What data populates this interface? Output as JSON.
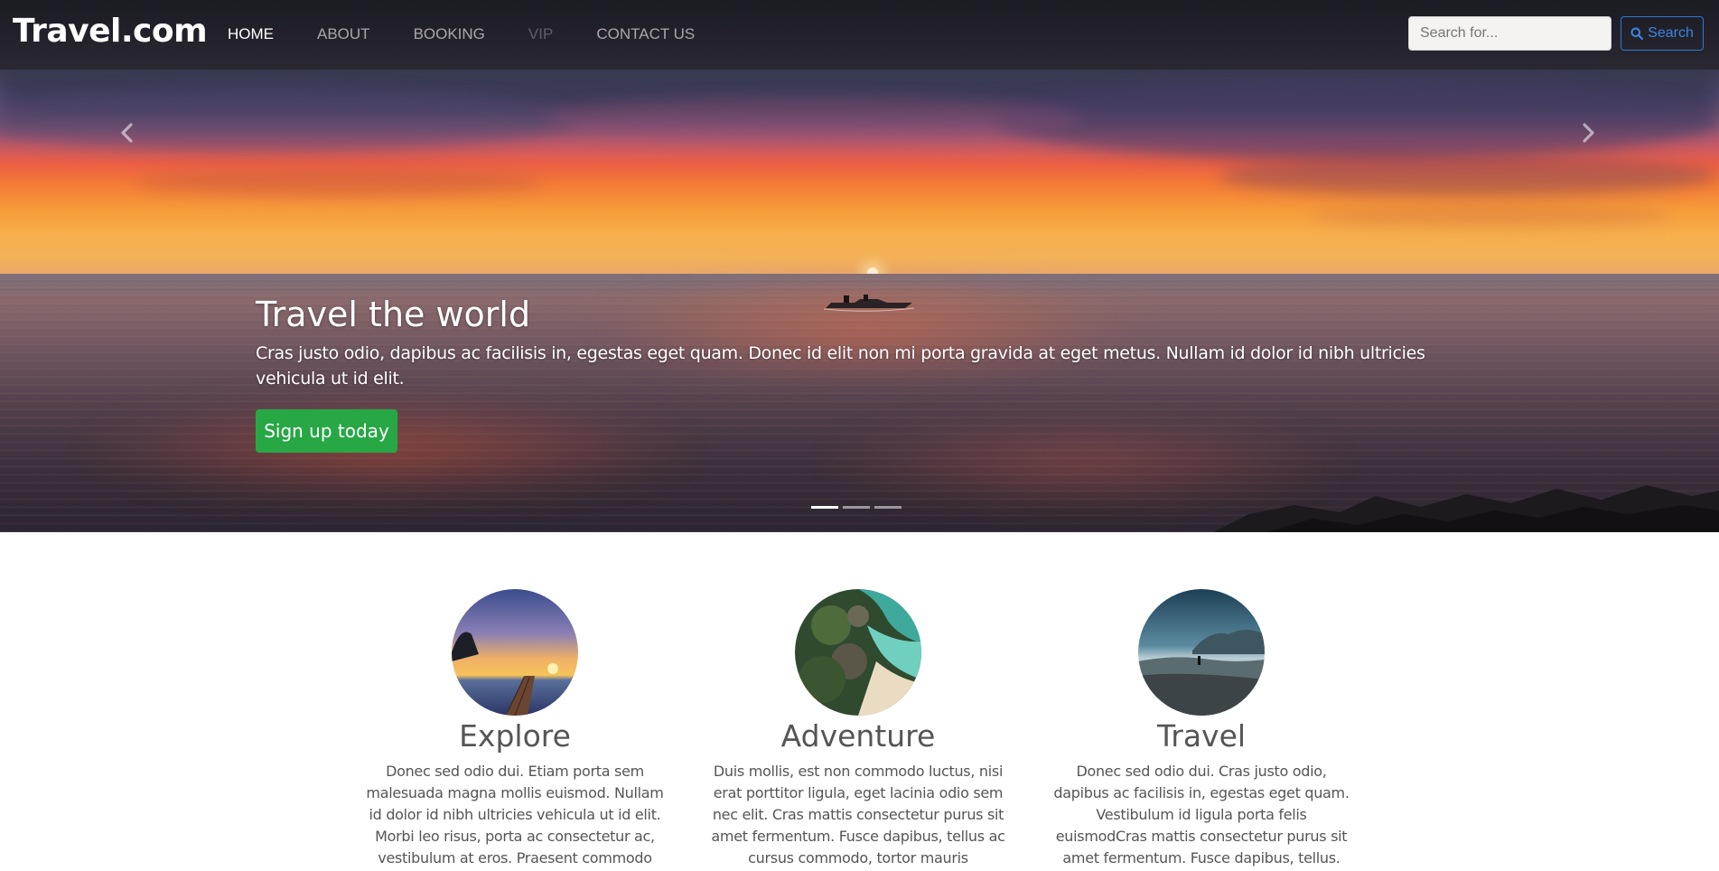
{
  "navbar": {
    "brand": "Travel.com",
    "links": [
      {
        "label": "HOME",
        "state": "active"
      },
      {
        "label": "ABOUT",
        "state": "normal"
      },
      {
        "label": "BOOKING",
        "state": "normal"
      },
      {
        "label": "VIP",
        "state": "disabled"
      },
      {
        "label": "CONTACT US",
        "state": "normal"
      }
    ],
    "search": {
      "placeholder": "Search for...",
      "value": "",
      "button_label": "Search",
      "button_icon": "search-icon"
    }
  },
  "hero": {
    "title": "Travel the world",
    "text": "Cras justo odio, dapibus ac facilisis in, egestas eget quam. Donec id elit non mi porta gravida at eget metus. Nullam id dolor id nibh ultricies vehicula ut id elit.",
    "cta_label": "Sign up today",
    "prev_icon": "chevron-left-icon",
    "next_icon": "chevron-right-icon",
    "slide_count": 3,
    "active_slide": 1
  },
  "features": [
    {
      "title": "Explore",
      "text": "Donec sed odio dui. Etiam porta sem malesuada magna mollis euismod. Nullam id dolor id nibh ultricies vehicula ut id elit. Morbi leo risus, porta ac consectetur ac, vestibulum at eros. Praesent commodo cursus magna."
    },
    {
      "title": "Adventure",
      "text": "Duis mollis, est non commodo luctus, nisi erat porttitor ligula, eget lacinia odio sem nec elit. Cras mattis consectetur purus sit amet fermentum. Fusce dapibus, tellus ac cursus commodo, tortor mauris condimentum nibh."
    },
    {
      "title": "Travel",
      "text": "Donec sed odio dui. Cras justo odio, dapibus ac facilisis in, egestas eget quam. Vestibulum id ligula porta felis euismodCras mattis consectetur purus sit amet fermentum. Fusce dapibus, tellus."
    }
  ],
  "colors": {
    "cta": "#28a745",
    "search_accent": "#2f79d6",
    "navbar_bg": "#1b1b22"
  }
}
